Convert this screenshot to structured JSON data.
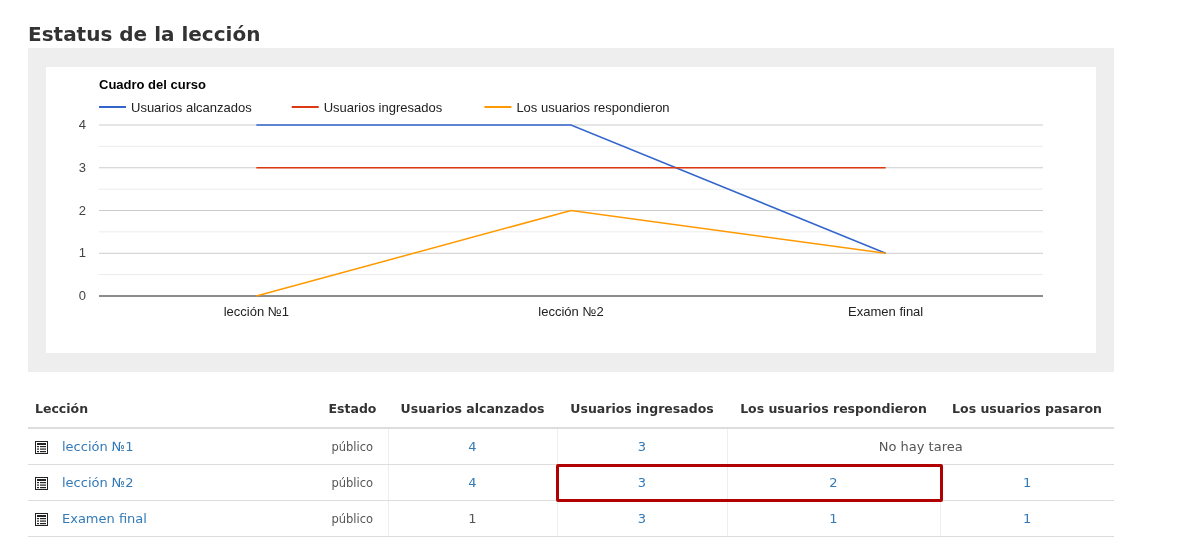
{
  "title": "Estatus de la lección",
  "chart": {
    "chart_data": {
      "type": "line",
      "title": "Cuadro del curso",
      "categories": [
        "lección №1",
        "lección №2",
        "Examen final"
      ],
      "ylim": [
        0,
        4
      ],
      "yticks": [
        0,
        1,
        2,
        3,
        4
      ],
      "grid": true,
      "legend": true,
      "series": [
        {
          "name": "Usuarios alcanzados",
          "color": "#3366cc",
          "values": [
            4,
            4,
            1
          ]
        },
        {
          "name": "Usuarios ingresados",
          "color": "#dc3912",
          "values": [
            3,
            3,
            3
          ]
        },
        {
          "name": "Los usuarios respondieron",
          "color": "#ff9900",
          "values": [
            0,
            2,
            1
          ]
        }
      ]
    }
  },
  "table": {
    "columns": [
      "Lección",
      "Estado",
      "Usuarios alcanzados",
      "Usuarios ingresados",
      "Los usuarios respondieron",
      "Los usuarios pasaron"
    ],
    "rows": [
      {
        "cells": [
          {
            "kind": "lesson",
            "text": "lección №1",
            "highlighted": false
          },
          {
            "kind": "status",
            "text": "público",
            "highlighted": false
          },
          {
            "kind": "link",
            "text": "4",
            "highlighted": false
          },
          {
            "kind": "link",
            "text": "3",
            "highlighted": false
          },
          {
            "kind": "note",
            "text": "No hay tarea",
            "colspan": 2,
            "highlighted": false
          }
        ]
      },
      {
        "cells": [
          {
            "kind": "lesson",
            "text": "lección №2",
            "highlighted": false
          },
          {
            "kind": "status",
            "text": "público",
            "highlighted": false
          },
          {
            "kind": "link",
            "text": "4",
            "highlighted": false
          },
          {
            "kind": "link",
            "text": "3",
            "highlighted": true
          },
          {
            "kind": "link",
            "text": "2",
            "highlighted": true
          },
          {
            "kind": "link",
            "text": "1",
            "highlighted": false
          }
        ]
      },
      {
        "cells": [
          {
            "kind": "lesson",
            "text": "Examen final",
            "highlighted": false
          },
          {
            "kind": "status",
            "text": "público",
            "highlighted": false
          },
          {
            "kind": "plain",
            "text": "1",
            "highlighted": false
          },
          {
            "kind": "link",
            "text": "3",
            "highlighted": false
          },
          {
            "kind": "link",
            "text": "1",
            "highlighted": false
          },
          {
            "kind": "link",
            "text": "1",
            "highlighted": false
          }
        ]
      }
    ]
  }
}
